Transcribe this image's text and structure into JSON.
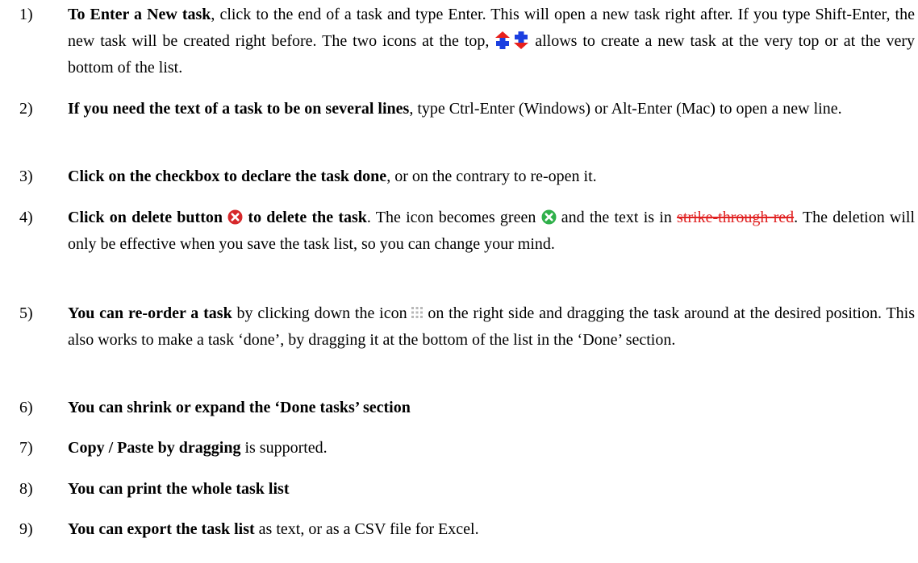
{
  "items": [
    {
      "number": "1)",
      "bold": "To Enter a New task",
      "text_a": ", click to the end of a task and type Enter. This will open a new task right after. If you type Shift-Enter, the new task will be created right before. The two icons at the top,",
      "text_b": "allows to create a new task at the very top or at the very bottom of the list."
    },
    {
      "number": "2)",
      "bold": "If you need the text of a task to be on several lines",
      "text_a": ", type Ctrl-Enter (Windows) or Alt-Enter (Mac) to open a new line."
    },
    {
      "number": "3)",
      "bold": "Click on the checkbox to declare the task done",
      "text_a": ", or on the contrary to re-open it."
    },
    {
      "number": "4)",
      "bold_a": "Click on delete button",
      "bold_b": "to delete the task",
      "text_a": ". The icon becomes green",
      "text_b": "and the text is in",
      "strike": "strike-through red",
      "text_c": ". The deletion will only be effective when you save the task list, so you can change your mind."
    },
    {
      "number": "5)",
      "bold": "You can re-order a task",
      "text_a": "by clicking down the icon",
      "text_b": "on the right side and dragging the task around at the desired position. This also works to make a task ‘done’, by dragging it at the bottom of the list in the ‘Done’ section."
    },
    {
      "number": "6)",
      "bold": "You can shrink or expand the ‘Done tasks’ section"
    },
    {
      "number": "7)",
      "bold": "Copy / Paste by dragging",
      "text_a": " is supported."
    },
    {
      "number": "8)",
      "bold": "You can print the whole task list"
    },
    {
      "number": "9)",
      "bold": "You can export the task list",
      "text_a": " as text, or as a CSV file for Excel."
    }
  ],
  "icons": {
    "add_top": "add-task-top-icon",
    "add_bottom": "add-task-bottom-icon",
    "delete_red": "delete-red-icon",
    "delete_green": "delete-green-icon",
    "drag_handle": "drag-handle-icon"
  },
  "colors": {
    "arrow_red": "#e8201c",
    "arrow_blue": "#1b3fe0",
    "delete_red": "#d6282b",
    "delete_green": "#2fb04a",
    "strike_red": "#e02020",
    "drag_gray": "#b8b8b8"
  }
}
